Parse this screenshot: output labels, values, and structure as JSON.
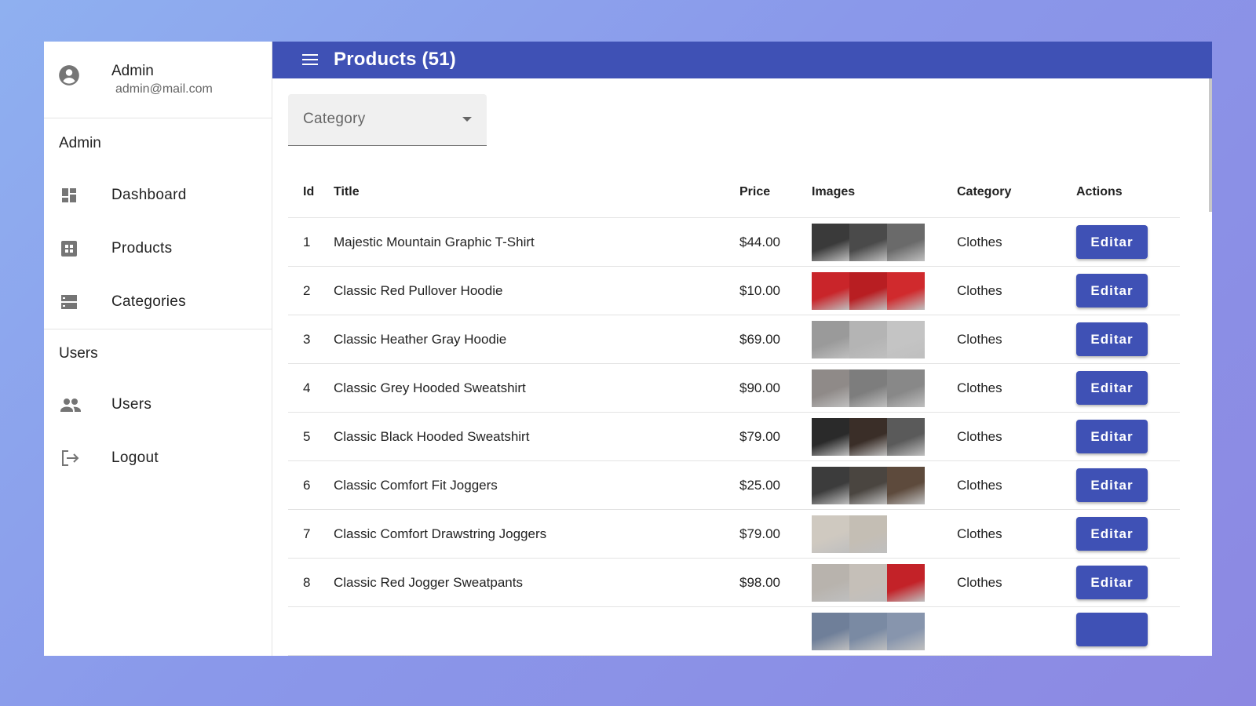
{
  "profile": {
    "name": "Admin",
    "email": "admin@mail.com",
    "avatar_icon": "account-circle-icon"
  },
  "sidebar": {
    "admin_header": "Admin",
    "admin_items": [
      {
        "label": "Dashboard",
        "icon": "dashboard-icon"
      },
      {
        "label": "Products",
        "icon": "grid-icon"
      },
      {
        "label": "Categories",
        "icon": "storage-icon"
      }
    ],
    "users_header": "Users",
    "users_items": [
      {
        "label": "Users",
        "icon": "people-icon"
      },
      {
        "label": "Logout",
        "icon": "logout-icon"
      }
    ]
  },
  "appbar": {
    "title": "Products (51)",
    "menu_icon": "menu-icon",
    "color": "#3f51b5"
  },
  "filter": {
    "label": "Category"
  },
  "table": {
    "headers": [
      "Id",
      "Title",
      "Price",
      "Images",
      "Category",
      "Actions"
    ],
    "rows": [
      {
        "id": "1",
        "title": "Majestic Mountain Graphic T-Shirt",
        "price": "$44.00",
        "category": "Clothes",
        "action": "Editar",
        "images": [
          "#3a3a3a",
          "#4a4a4a",
          "#6a6a6a"
        ]
      },
      {
        "id": "2",
        "title": "Classic Red Pullover Hoodie",
        "price": "$10.00",
        "category": "Clothes",
        "action": "Editar",
        "images": [
          "#c9252a",
          "#b81e22",
          "#d02a2d"
        ]
      },
      {
        "id": "3",
        "title": "Classic Heather Gray Hoodie",
        "price": "$69.00",
        "category": "Clothes",
        "action": "Editar",
        "images": [
          "#9a9a9a",
          "#b4b4b4",
          "#c4c4c4"
        ]
      },
      {
        "id": "4",
        "title": "Classic Grey Hooded Sweatshirt",
        "price": "$90.00",
        "category": "Clothes",
        "action": "Editar",
        "images": [
          "#8f8a88",
          "#7d7d7d",
          "#888888"
        ]
      },
      {
        "id": "5",
        "title": "Classic Black Hooded Sweatshirt",
        "price": "$79.00",
        "category": "Clothes",
        "action": "Editar",
        "images": [
          "#2a2a2a",
          "#3a2e28",
          "#5a5a5a"
        ]
      },
      {
        "id": "6",
        "title": "Classic Comfort Fit Joggers",
        "price": "$25.00",
        "category": "Clothes",
        "action": "Editar",
        "images": [
          "#3c3c3c",
          "#4a4540",
          "#5d4a3c"
        ]
      },
      {
        "id": "7",
        "title": "Classic Comfort Drawstring Joggers",
        "price": "$79.00",
        "category": "Clothes",
        "action": "Editar",
        "images": [
          "#cfc9c0",
          "#c4beb4"
        ]
      },
      {
        "id": "8",
        "title": "Classic Red Jogger Sweatpants",
        "price": "$98.00",
        "category": "Clothes",
        "action": "Editar",
        "images": [
          "#b8b3ad",
          "#c5bfb8",
          "#c32228"
        ]
      },
      {
        "id": "",
        "title": "",
        "price": "",
        "category": "",
        "action": "",
        "images": [
          "#6f7f99",
          "#7a8aa3",
          "#8795ad"
        ]
      }
    ]
  }
}
